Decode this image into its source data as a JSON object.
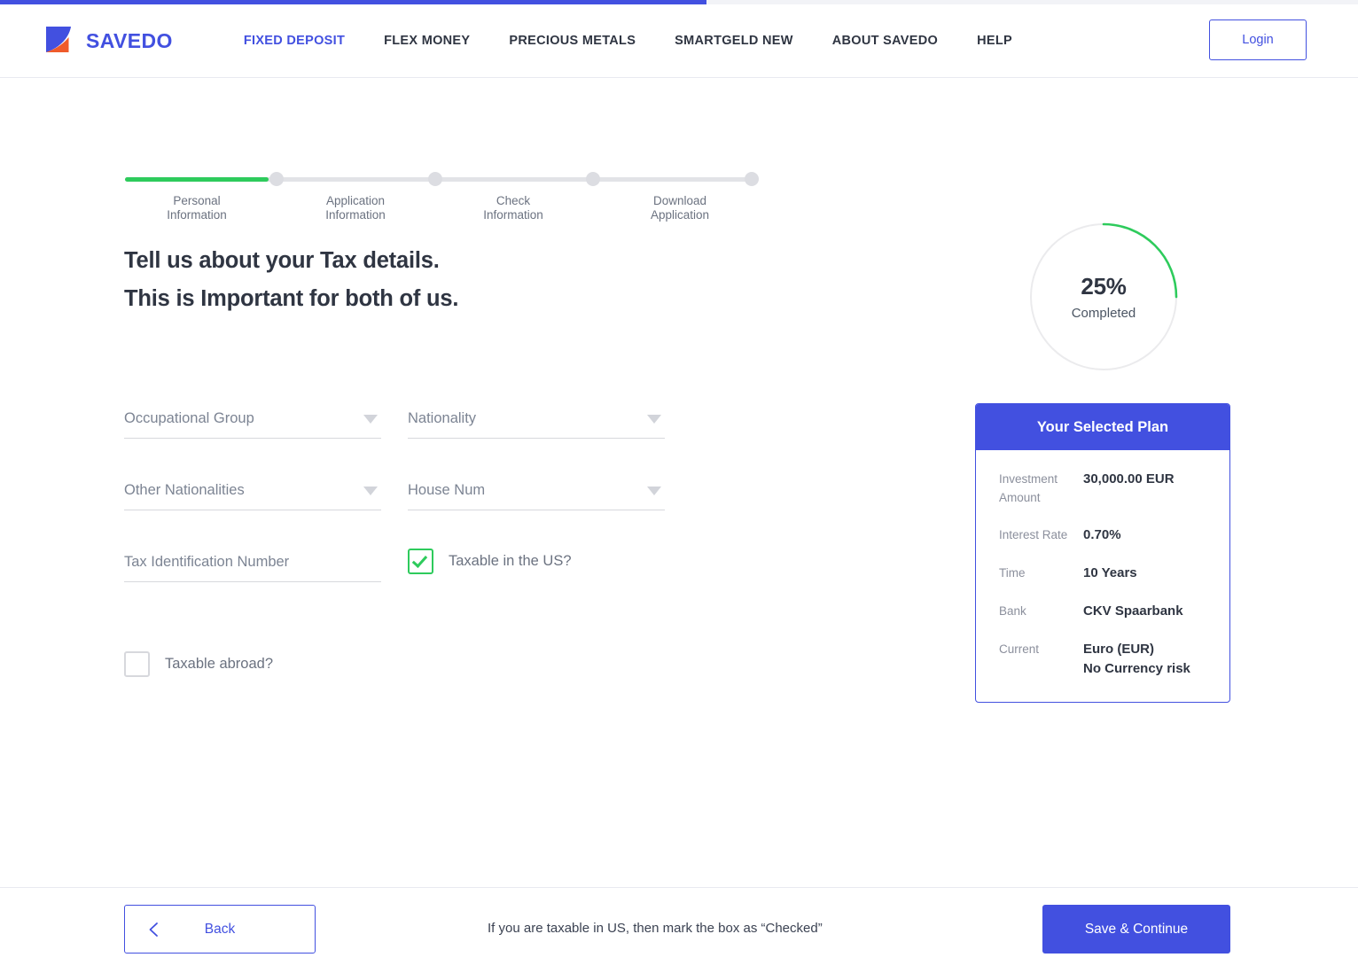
{
  "top_progress": {
    "percent": 52
  },
  "header": {
    "brand_name": "SAVEDO",
    "nav": [
      {
        "label": "FIXED DEPOSIT",
        "active": true
      },
      {
        "label": "FLEX MONEY",
        "active": false
      },
      {
        "label": "PRECIOUS METALS",
        "active": false
      },
      {
        "label": "SMARTGELD NEW",
        "active": false
      },
      {
        "label": "ABOUT SAVEDO",
        "active": false
      },
      {
        "label": "HELP",
        "active": false
      }
    ],
    "login_label": "Login",
    "accent_color": "#4250e0"
  },
  "stepper": {
    "steps": [
      {
        "line1": "Personal",
        "line2": "Information"
      },
      {
        "line1": "Application",
        "line2": "Information"
      },
      {
        "line1": "Check",
        "line2": "Information"
      },
      {
        "line1": "Download",
        "line2": "Application"
      }
    ],
    "completed_color": "#2ecb5c",
    "track_color": "#e2e3e7"
  },
  "main": {
    "headline_line1": "Tell us about your Tax details.",
    "headline_line2": "This is Important for both of us.",
    "fields": {
      "occupational_group": {
        "placeholder": "Occupational Group",
        "value": ""
      },
      "nationality": {
        "placeholder": "Nationality",
        "value": ""
      },
      "other_nationalities": {
        "placeholder": "Other Nationalities",
        "value": ""
      },
      "house_num": {
        "placeholder": "House Num",
        "value": ""
      },
      "tax_identification_number": {
        "placeholder": "Tax Identification Number",
        "value": ""
      }
    },
    "checkboxes": {
      "taxable_us": {
        "label": "Taxable in the US?",
        "checked": true,
        "color": "#2ecb5c"
      },
      "taxable_abroad": {
        "label": "Taxable abroad?",
        "checked": false
      }
    }
  },
  "progress": {
    "percent_label": "25%",
    "sub_label": "Completed",
    "percent_value": 25,
    "ring_color": "#2ecb5c",
    "track_color": "#ebebed"
  },
  "plan_card": {
    "title": "Your Selected Plan",
    "rows": [
      {
        "key": "Investment Amount",
        "value": "30,000.00 EUR"
      },
      {
        "key": "Interest Rate",
        "value": "0.70%"
      },
      {
        "key": "Time",
        "value": "10 Years"
      },
      {
        "key": "Bank",
        "value": "CKV Spaarbank"
      },
      {
        "key": "Current",
        "value": "Euro (EUR)\nNo Currency risk"
      }
    ],
    "header_color": "#4250e0"
  },
  "footer": {
    "back_label": "Back",
    "hint": "If you are taxable in US, then mark the box as “Checked”",
    "save_label": "Save & Continue"
  }
}
